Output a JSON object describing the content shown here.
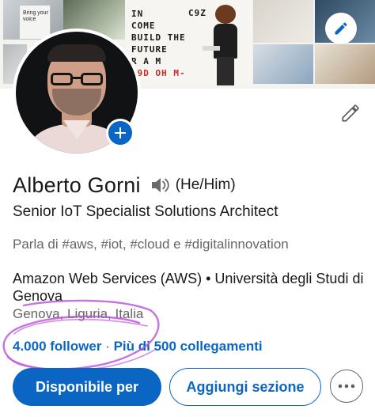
{
  "banner": {
    "bag_text": "Bring your voice",
    "poster_lines": [
      "IN",
      "COME",
      "BUILD THE",
      "FUTURE",
      "R A M",
      "39D OH M-"
    ],
    "poster_corner": "C9Z"
  },
  "profile": {
    "name": "Alberto Gorni",
    "pronouns": "(He/Him)",
    "headline": "Senior IoT Specialist Solutions Architect",
    "talks_about": "Parla di #aws, #iot, #cloud e #digitalinnovation",
    "company_education": "Amazon Web Services (AWS) • Università degli Studi di Genova",
    "location": "Genova, Liguria, Italia",
    "followers": "4.000 follower",
    "separator": "·",
    "connections": "Più di 500 collegamenti"
  },
  "actions": {
    "primary_label": "Disponibile per",
    "secondary_label": "Aggiungi sezione"
  },
  "icons": {
    "edit_banner": "pencil-icon",
    "edit_profile": "pencil-icon",
    "add_photo": "plus-icon",
    "pronunciation": "speaker-icon",
    "more": "ellipsis-icon"
  },
  "colors": {
    "brand_blue": "#0a66c2",
    "text_primary": "#191919",
    "text_secondary": "#666666",
    "annotation": "#b94fd8"
  }
}
